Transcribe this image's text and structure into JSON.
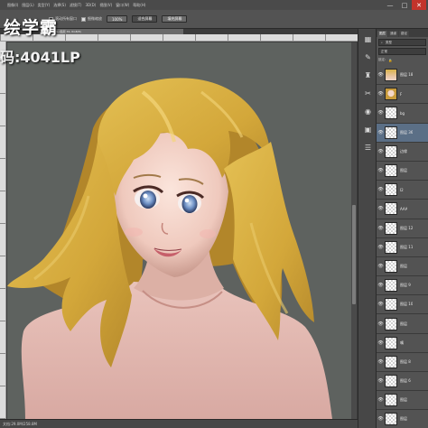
{
  "menubar": {
    "items": [
      "图像(I)",
      "图层(L)",
      "类型(Y)",
      "选择(S)",
      "滤镜(T)",
      "3D(D)",
      "视图(V)",
      "窗口(W)",
      "帮助(H)"
    ],
    "window_buttons": [
      "—",
      "□",
      "✕"
    ]
  },
  "options": {
    "scroll_all_label": "滚动所有窗口",
    "scroll_all_checked": false,
    "scrubby_zoom_label": "细微缩放",
    "scrubby_zoom_checked": true,
    "btn_100": "100%",
    "btn_fit_screen": "适合屏幕",
    "btn_fill_screen": "填充屏幕"
  },
  "watermark": {
    "logo": "绘学霸",
    "code": "码:4041LP"
  },
  "document": {
    "tab_title": "@ 29.5% (图层 36, RGB/8)"
  },
  "statusbar": {
    "text": "文档:29.0M/258.8M"
  },
  "dock": {
    "icons": [
      "brush-settings-icon",
      "clone-source-icon",
      "history-icon",
      "actions-icon",
      "swatches-icon",
      "adjustments-icon",
      "properties-icon"
    ]
  },
  "layers_panel": {
    "tabs": [
      "图层",
      "通道",
      "路径"
    ],
    "filter_label": "类型",
    "blend_mode": "正常",
    "lock_label": "锁定:",
    "layers": [
      {
        "name": "图层 18",
        "thumb": "art",
        "visible": true,
        "selected": false
      },
      {
        "name": "F",
        "thumb": "face",
        "visible": true,
        "selected": false
      },
      {
        "name": "bg",
        "thumb": "checker",
        "visible": true,
        "selected": false
      },
      {
        "name": "图层 36",
        "thumb": "checker",
        "visible": true,
        "selected": true
      },
      {
        "name": "边缘",
        "thumb": "checker",
        "visible": true,
        "selected": false
      },
      {
        "name": "图层",
        "thumb": "checker",
        "visible": true,
        "selected": false
      },
      {
        "name": "I2",
        "thumb": "checker",
        "visible": true,
        "selected": false
      },
      {
        "name": "AAA",
        "thumb": "checker",
        "visible": true,
        "selected": false
      },
      {
        "name": "图层 12",
        "thumb": "checker",
        "visible": true,
        "selected": false
      },
      {
        "name": "图层 11",
        "thumb": "checker",
        "visible": true,
        "selected": false
      },
      {
        "name": "图层",
        "thumb": "checker",
        "visible": true,
        "selected": false
      },
      {
        "name": "图层 9",
        "thumb": "checker",
        "visible": true,
        "selected": false
      },
      {
        "name": "图层 10",
        "thumb": "checker",
        "visible": true,
        "selected": false
      },
      {
        "name": "图层",
        "thumb": "checker",
        "visible": true,
        "selected": false
      },
      {
        "name": "嘴",
        "thumb": "checker",
        "visible": true,
        "selected": false
      },
      {
        "name": "图层 8",
        "thumb": "checker",
        "visible": true,
        "selected": false
      },
      {
        "name": "图层 6",
        "thumb": "checker",
        "visible": true,
        "selected": false
      },
      {
        "name": "图层",
        "thumb": "checker",
        "visible": true,
        "selected": false
      },
      {
        "name": "图层",
        "thumb": "checker",
        "visible": true,
        "selected": false
      }
    ]
  },
  "colors": {
    "canvas_bg": "#5e625f",
    "panel_bg": "#535353",
    "selected_layer": "#5b6f86",
    "hair": "#d6ad3c",
    "skin": "#f0d2c4",
    "close_button": "#c2342b"
  }
}
